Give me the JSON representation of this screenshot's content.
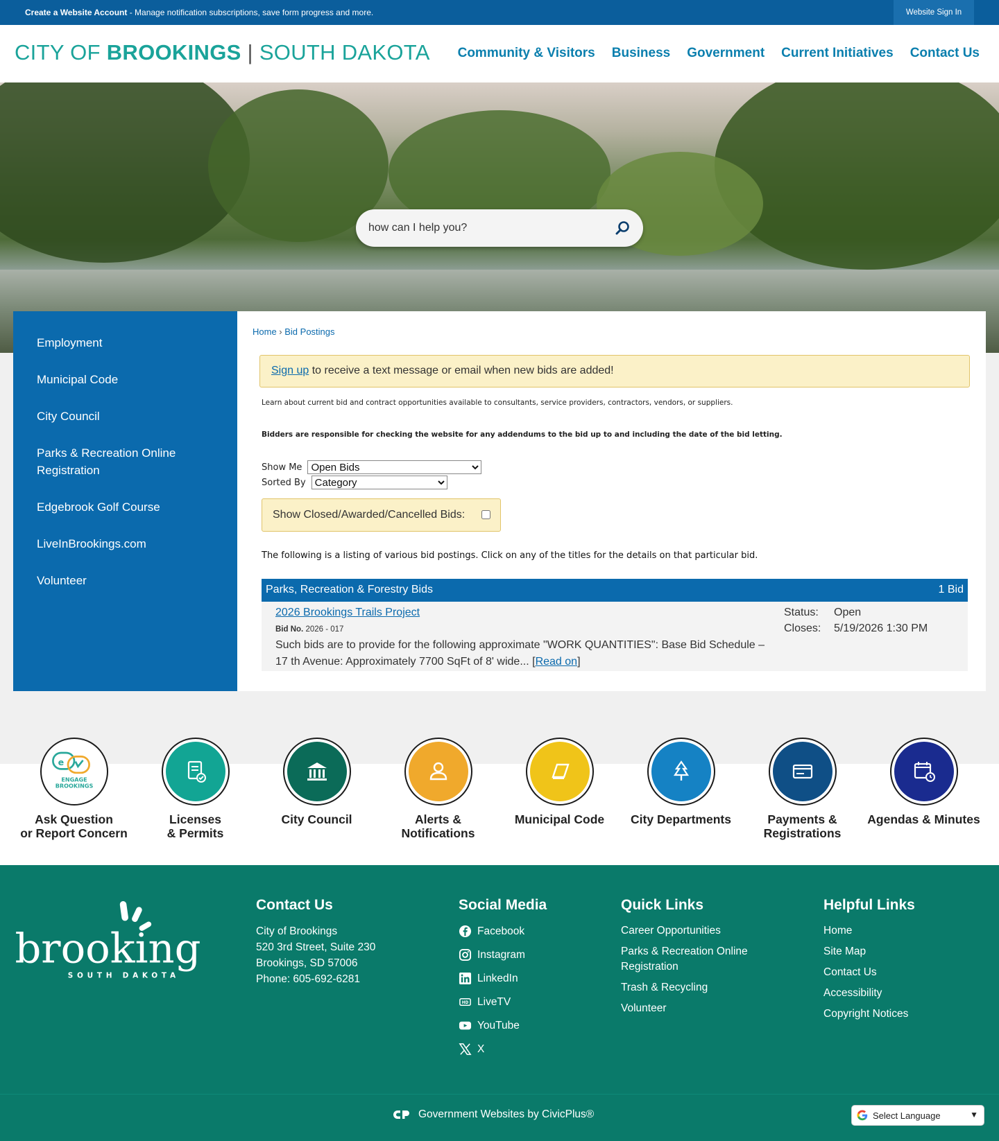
{
  "topbar": {
    "create_account": "Create a Website Account",
    "message": " - Manage notification subscriptions, save form progress and more.",
    "sign_in": "Website Sign In"
  },
  "header": {
    "logo_city_of": "CITY OF ",
    "logo_brookings": "BROOKINGS",
    "logo_sep": " | ",
    "logo_state": "SOUTH DAKOTA",
    "nav": [
      "Community & Visitors",
      "Business",
      "Government",
      "Current Initiatives",
      "Contact Us"
    ]
  },
  "search": {
    "placeholder": "how can I help you?"
  },
  "sidebar": {
    "items": [
      "Employment",
      "Municipal Code",
      "City Council",
      "Parks & Recreation Online Registration",
      "Edgebrook Golf Course",
      "LiveInBrookings.com",
      "Volunteer"
    ]
  },
  "breadcrumb": {
    "home": "Home",
    "sep": " › ",
    "current": "Bid Postings"
  },
  "alert": {
    "link": "Sign up",
    "text": " to receive a text message or email when new bids are added!"
  },
  "intro": {
    "learn": "Learn about current bid and contract opportunities available to consultants, service providers, contractors, vendors, or suppliers.",
    "bidders": "Bidders are responsible for checking the website for any addendums to the bid up to and including the date of the bid letting."
  },
  "filters": {
    "show_me_label": "Show Me",
    "show_me_value": "Open Bids",
    "sorted_by_label": "Sorted By",
    "sorted_by_value": "Category",
    "closed_label": "Show Closed/Awarded/Cancelled Bids:"
  },
  "listing_text": "The following is a listing of various bid postings. Click on any of the titles for the details on that particular bid.",
  "bid_category": {
    "name": "Parks, Recreation & Forestry Bids",
    "count": "1 Bid"
  },
  "bid": {
    "title": "2026 Brookings Trails Project",
    "bid_no_label": "Bid No.",
    "bid_no": " 2026 - 017",
    "description": "Such bids are to provide for the following approximate \"WORK QUANTITIES\": Base Bid Schedule – 17 th Avenue: Approximately 7700 SqFt of 8' wide... ",
    "read_on": "Read on",
    "bracket_open": "[",
    "bracket_close": "]",
    "status_label": "Status:",
    "status": "Open",
    "closes_label": "Closes:",
    "closes": "5/19/2026 1:30 PM"
  },
  "quick_links": [
    {
      "line1": "Ask Question",
      "line2": "or Report Concern",
      "icon": "engage-brookings-icon",
      "color": "#ffffff"
    },
    {
      "line1": "Licenses",
      "line2": "& Permits",
      "icon": "permit-document-icon",
      "color": "#12a594"
    },
    {
      "line1": "City Council",
      "line2": "",
      "icon": "government-building-icon",
      "color": "#0b6b58"
    },
    {
      "line1": "Alerts &",
      "line2": "Notifications",
      "icon": "person-alert-icon",
      "color": "#f0a92c"
    },
    {
      "line1": "Municipal Code",
      "line2": "",
      "icon": "book-icon",
      "color": "#f0c419"
    },
    {
      "line1": "City Departments",
      "line2": "",
      "icon": "tree-icon",
      "color": "#1582c4"
    },
    {
      "line1": "Payments &",
      "line2": "Registrations",
      "icon": "credit-card-icon",
      "color": "#0f4f86"
    },
    {
      "line1": "Agendas & Minutes",
      "line2": "",
      "icon": "calendar-clock-icon",
      "color": "#1a2b8f"
    }
  ],
  "footer": {
    "logo_word": "brookings",
    "logo_sub": "SOUTH DAKOTA",
    "contact": {
      "heading": "Contact Us",
      "lines": [
        "City of Brookings",
        "520 3rd Street, Suite 230",
        "Brookings, SD 57006",
        "Phone: 605-692-6281"
      ]
    },
    "social": {
      "heading": "Social Media",
      "items": [
        "Facebook",
        "Instagram",
        "LinkedIn",
        "LiveTV",
        "YouTube",
        "X"
      ]
    },
    "quick": {
      "heading": "Quick Links",
      "items": [
        "Career Opportunities",
        "Parks & Recreation Online Registration",
        "Trash & Recycling",
        "Volunteer"
      ]
    },
    "helpful": {
      "heading": "Helpful Links",
      "items": [
        "Home",
        "Site Map",
        "Contact Us",
        "Accessibility",
        "Copyright Notices"
      ]
    },
    "civicplus": "Government Websites by CivicPlus®",
    "language": "Select Language"
  }
}
